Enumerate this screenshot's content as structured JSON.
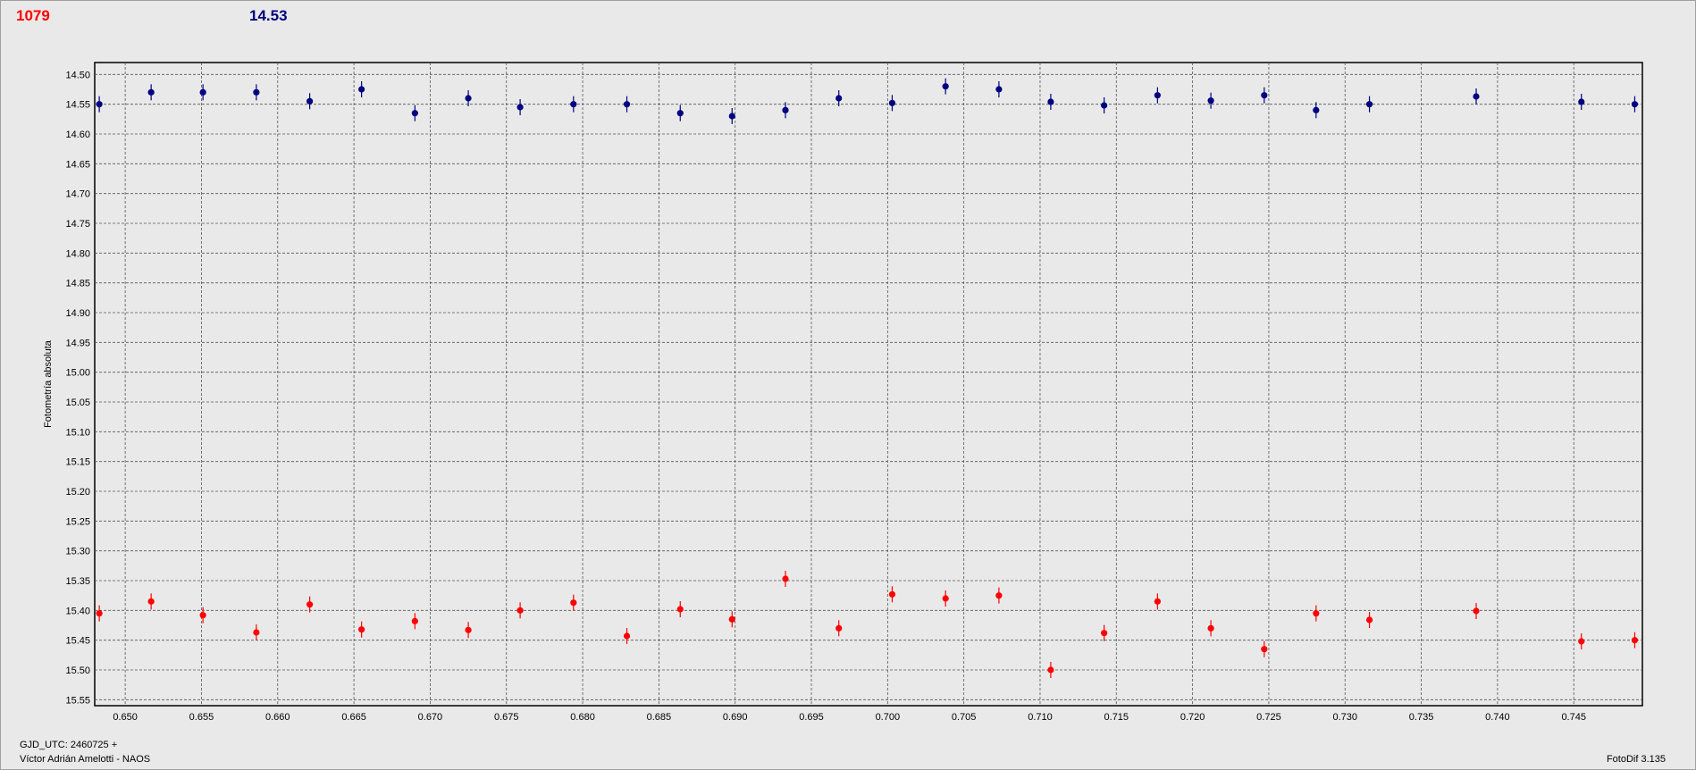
{
  "header": {
    "left_value": "1079",
    "right_value": "14.53",
    "left_color": "#ff0000",
    "right_color": "#000080"
  },
  "footer": {
    "gjd": "GJD_UTC: 2460725 +",
    "observer": "Víctor Adrián Amelotti - NAOS",
    "software": "FotoDif 3.135"
  },
  "chart_data": {
    "type": "scatter",
    "ylabel": "Fotometría absoluta",
    "xlabel": "",
    "xlim": [
      0.648,
      0.7495
    ],
    "ylim": [
      15.56,
      14.48
    ],
    "y_inverted": true,
    "grid": true,
    "x_ticks": [
      "0.650",
      "0.655",
      "0.660",
      "0.665",
      "0.670",
      "0.675",
      "0.680",
      "0.685",
      "0.690",
      "0.695",
      "0.700",
      "0.705",
      "0.710",
      "0.715",
      "0.720",
      "0.725",
      "0.730",
      "0.735",
      "0.740",
      "0.745"
    ],
    "y_ticks": [
      "14.50",
      "14.55",
      "14.60",
      "14.65",
      "14.70",
      "14.75",
      "14.80",
      "14.85",
      "14.90",
      "14.95",
      "15.00",
      "15.05",
      "15.10",
      "15.15",
      "15.20",
      "15.25",
      "15.30",
      "15.35",
      "15.40",
      "15.45",
      "15.50",
      "15.55"
    ],
    "series": [
      {
        "color": "#000080",
        "x": [
          0.6483,
          0.6517,
          0.6551,
          0.6586,
          0.6621,
          0.6655,
          0.669,
          0.6725,
          0.6759,
          0.6794,
          0.6829,
          0.6864,
          0.6898,
          0.6933,
          0.6968,
          0.7003,
          0.7038,
          0.7073,
          0.7107,
          0.7142,
          0.7177,
          0.7212,
          0.7247,
          0.7281,
          0.7316,
          0.7386,
          0.7455,
          0.749
        ],
        "y": [
          14.55,
          14.53,
          14.53,
          14.53,
          14.545,
          14.525,
          14.565,
          14.54,
          14.555,
          14.55,
          14.55,
          14.565,
          14.57,
          14.56,
          14.54,
          14.548,
          14.52,
          14.525,
          14.546,
          14.552,
          14.535,
          14.544,
          14.535,
          14.56,
          14.55,
          14.537,
          14.546,
          14.55
        ]
      },
      {
        "color": "#ff0000",
        "x": [
          0.6483,
          0.6517,
          0.6551,
          0.6586,
          0.6621,
          0.6655,
          0.669,
          0.6725,
          0.6759,
          0.6794,
          0.6829,
          0.6864,
          0.6898,
          0.6933,
          0.6968,
          0.7003,
          0.7038,
          0.7073,
          0.7107,
          0.7142,
          0.7177,
          0.7212,
          0.7247,
          0.7281,
          0.7316,
          0.7386,
          0.7455,
          0.749
        ],
        "y": [
          15.405,
          15.385,
          15.408,
          15.437,
          15.39,
          15.432,
          15.418,
          15.433,
          15.4,
          15.387,
          15.443,
          15.398,
          15.415,
          15.347,
          15.43,
          15.373,
          15.38,
          15.375,
          15.5,
          15.438,
          15.385,
          15.43,
          15.465,
          15.405,
          15.416,
          15.401,
          15.452,
          15.45
        ]
      }
    ]
  }
}
